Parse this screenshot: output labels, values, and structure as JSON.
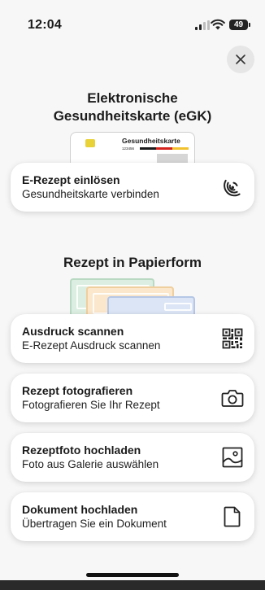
{
  "status_bar": {
    "time": "12:04",
    "battery": "49"
  },
  "sections": {
    "egk": {
      "heading_line1": "Elektronische",
      "heading_line2": "Gesundheitskarte (eGK)"
    },
    "paper": {
      "heading": "Rezept in Papierform"
    }
  },
  "egk_card": {
    "label": "Gesundheitskarte",
    "number": "123456"
  },
  "actions": [
    {
      "title": "E-Rezept einlösen",
      "subtitle": "Gesundheitskarte verbinden",
      "icon": "nfc-icon"
    },
    {
      "title": "Ausdruck scannen",
      "subtitle": "E-Rezept Ausdruck scannen",
      "icon": "qr-code-icon"
    },
    {
      "title": "Rezept fotografieren",
      "subtitle": "Fotografieren Sie Ihr Rezept",
      "icon": "camera-icon"
    },
    {
      "title": "Rezeptfoto hochladen",
      "subtitle": "Foto aus Galerie auswählen",
      "icon": "image-icon"
    },
    {
      "title": "Dokument hochladen",
      "subtitle": "Übertragen Sie ein Dokument",
      "icon": "document-icon"
    }
  ],
  "colors": {
    "background": "#f7f7f7",
    "card": "#ffffff",
    "chip": "#e8d238",
    "flag_black": "#1a1a1a",
    "flag_red": "#d4221c",
    "flag_gold": "#f2c12e"
  }
}
